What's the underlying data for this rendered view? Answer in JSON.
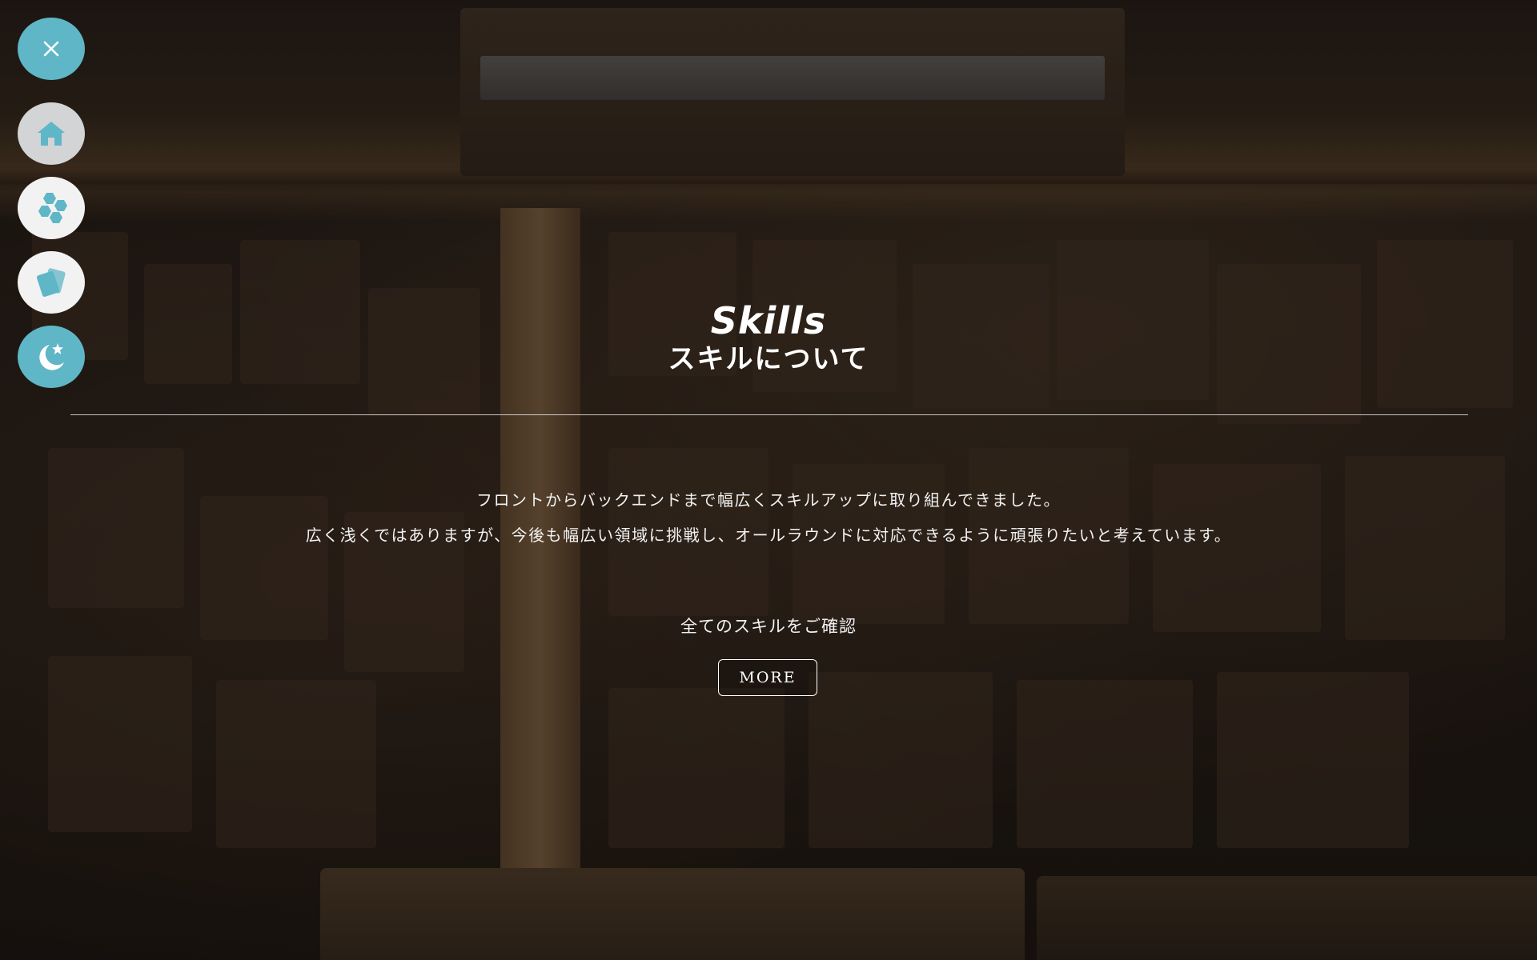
{
  "nav": {
    "items": [
      {
        "icon": "close-icon",
        "color": "#5fb6c6"
      },
      {
        "icon": "home-icon",
        "color": "#d2d4d6"
      },
      {
        "icon": "hexagons-icon",
        "color": "#f2f2f2"
      },
      {
        "icon": "cards-icon",
        "color": "#f2f2f2"
      },
      {
        "icon": "moon-star-icon",
        "color": "#5fb6c6"
      }
    ]
  },
  "section": {
    "title_en": "Skills",
    "title_ja": "スキルについて",
    "description": [
      "フロントからバックエンドまで幅広くスキルアップに取り組んできました。",
      "広く浅くではありますが、今後も幅広い領域に挑戦し、オールラウンドに対応できるように頑張りたいと考えています。"
    ],
    "confirm_text": "全てのスキルをご確認",
    "more_label": "MORE"
  },
  "colors": {
    "accent": "#5fb6c6",
    "text": "#ffffff"
  }
}
